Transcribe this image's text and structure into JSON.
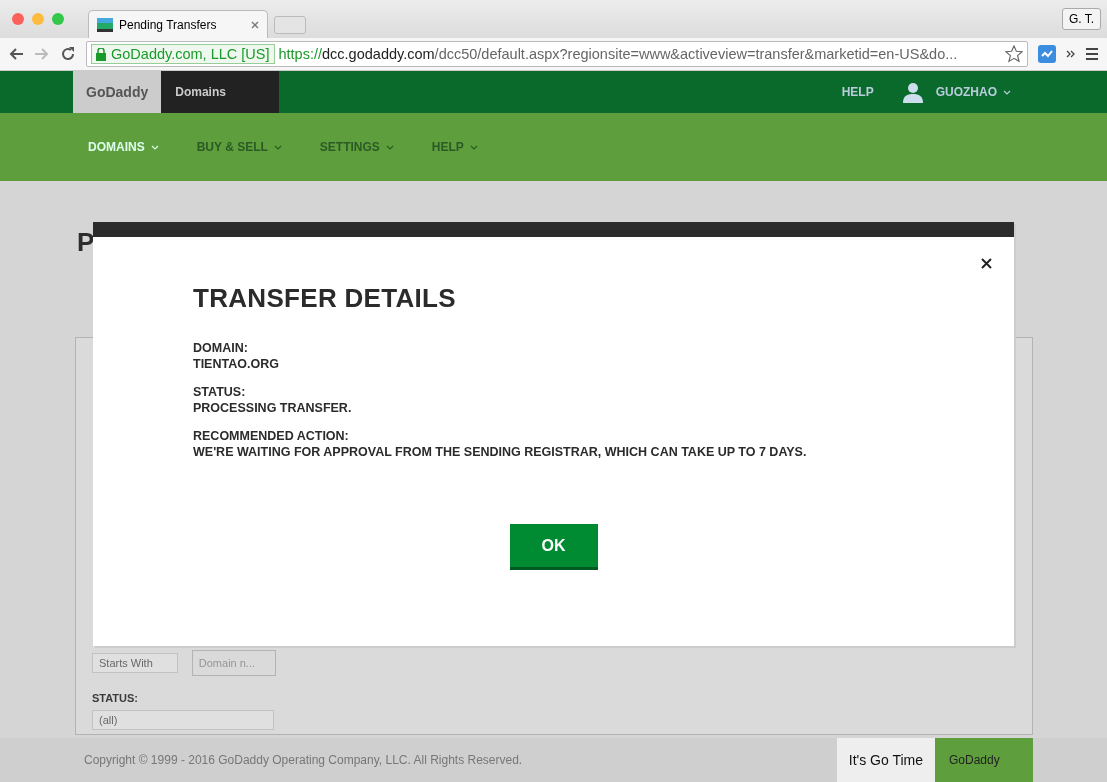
{
  "browser": {
    "tab_title": "Pending Transfers",
    "profile": "G. T.",
    "security_label": "GoDaddy.com, LLC [US]",
    "url_scheme": "https://",
    "url_host": "dcc.godaddy.com",
    "url_path": "/dcc50/default.aspx?regionsite=www&activeview=transfer&marketid=en-US&do..."
  },
  "header": {
    "logo": "GoDaddy",
    "product": "Domains",
    "help": "HELP",
    "user": "GUOZHAO"
  },
  "nav": [
    {
      "label": "DOMAINS",
      "selected": true
    },
    {
      "label": "BUY & SELL",
      "selected": false
    },
    {
      "label": "SETTINGS",
      "selected": false
    },
    {
      "label": "HELP",
      "selected": false
    }
  ],
  "page_title": "P",
  "filters": {
    "match_select": "Starts With",
    "domain_placeholder": "Domain n...",
    "status_label": "STATUS:",
    "status_select": "(all)"
  },
  "modal": {
    "title": "TRANSFER DETAILS",
    "fields": [
      {
        "label": "DOMAIN:",
        "value": "TIENTAO.ORG"
      },
      {
        "label": "STATUS:",
        "value": "PROCESSING TRANSFER."
      },
      {
        "label": "RECOMMENDED ACTION:",
        "value": "WE'RE WAITING FOR APPROVAL FROM THE SENDING REGISTRAR, WHICH CAN TAKE UP TO 7 DAYS."
      }
    ],
    "ok": "OK"
  },
  "footer": {
    "copyright": "Copyright © 1999 - 2016 GoDaddy Operating Company, LLC. All Rights Reserved.",
    "tagline": "It's Go Time",
    "logo": "GoDaddy"
  }
}
